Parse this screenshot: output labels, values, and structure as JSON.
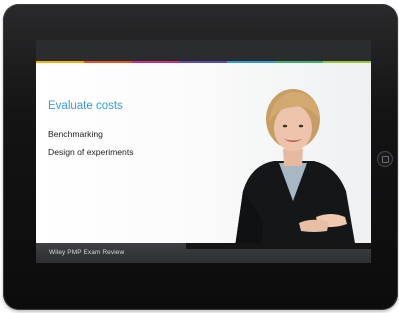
{
  "slide": {
    "title": "Evaluate costs",
    "bullets": [
      "Benchmarking",
      "Design of experiments"
    ]
  },
  "footer": {
    "label": "Wiley PMP Exam Review"
  },
  "colors": {
    "title_blue": "#3a9bd8",
    "accent_stripe": [
      "#f2b400",
      "#e2542a",
      "#c7308a",
      "#5b4ab8",
      "#2f9ad6",
      "#3eb06c",
      "#9bc33b"
    ]
  },
  "icons": {
    "home_button": "home-button-icon"
  }
}
